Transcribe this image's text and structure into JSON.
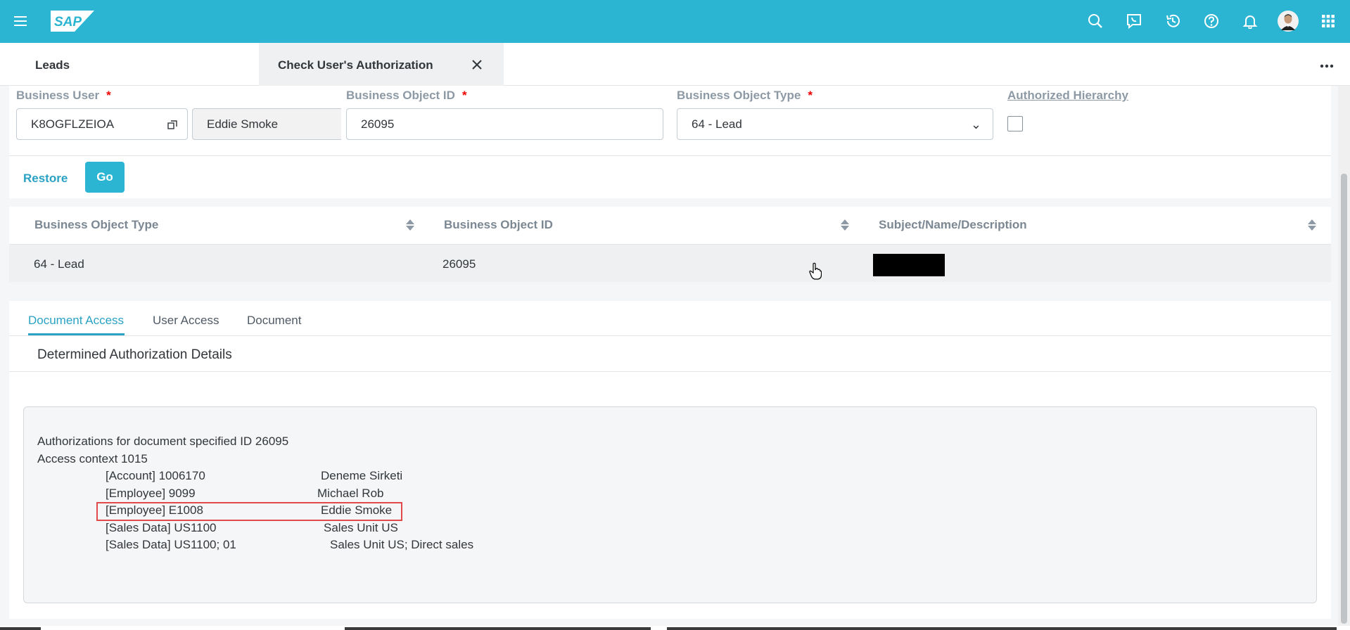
{
  "shell": {
    "logo_text": "SAP",
    "icons": [
      "menu-icon",
      "search-icon",
      "chat-icon",
      "history-icon",
      "help-icon",
      "notification-bell-icon",
      "avatar",
      "app-grid-icon"
    ]
  },
  "tabs": {
    "leads": "Leads",
    "active": "Check User's Authorization"
  },
  "filters": {
    "business_user_label": "Business User",
    "business_user_id": "K8OGFLZEIOA",
    "business_user_name": "Eddie Smoke",
    "object_id_label": "Business Object ID",
    "object_id_value": "26095",
    "object_type_label": "Business Object Type",
    "object_type_value": "64 - Lead",
    "authorized_hierarchy_label": "Authorized Hierarchy",
    "required_marker": "*",
    "restore_label": "Restore",
    "go_label": "Go"
  },
  "table": {
    "columns": [
      "Business Object Type",
      "Business Object ID",
      "Subject/Name/Description"
    ],
    "rows": [
      [
        "64 - Lead",
        "26095",
        ""
      ]
    ]
  },
  "detail": {
    "tabs": [
      "Document Access",
      "User Access",
      "Document"
    ],
    "section_title": "Determined Authorization Details",
    "header_lines": [
      "Authorizations for document specified ID 26095",
      "Access context 1015"
    ],
    "entries": [
      {
        "key": "[Account] 1006170",
        "value": "Deneme Sirketi"
      },
      {
        "key": "[Employee] 9099",
        "value": "Michael Rob"
      },
      {
        "key": "[Employee] E1008",
        "value": "Eddie Smoke"
      },
      {
        "key": "[Sales Data] US1100",
        "value": "Sales Unit US"
      },
      {
        "key": "[Sales Data] US1100; 01",
        "value": "Sales Unit US; Direct sales"
      }
    ]
  },
  "colors": {
    "shell": "#2cb5d2",
    "accent": "#2aa2c3",
    "required": "#e00000",
    "highlight_border": "#e04a4a"
  }
}
